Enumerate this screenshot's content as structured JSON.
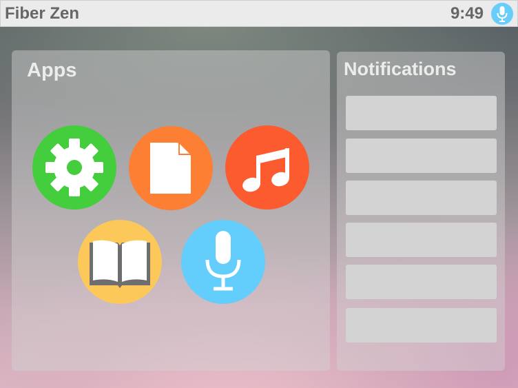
{
  "status_bar": {
    "title": "Fiber Zen",
    "time": "9:49",
    "icon": "microphone-icon"
  },
  "apps": {
    "title": "Apps",
    "items": [
      {
        "name": "settings",
        "icon": "gear-icon",
        "color": "#44cd3c"
      },
      {
        "name": "documents",
        "icon": "document-icon",
        "color": "#fc7f33"
      },
      {
        "name": "music",
        "icon": "music-note-icon",
        "color": "#fb5b2e"
      },
      {
        "name": "books",
        "icon": "book-icon",
        "color": "#fdc85a"
      },
      {
        "name": "voice",
        "icon": "microphone-icon",
        "color": "#63cdfb"
      }
    ]
  },
  "notifications": {
    "title": "Notifications",
    "slots": 6
  },
  "colors": {
    "status_bar_bg": "#ebebeb",
    "status_text": "#666666",
    "panel_text": "#ececec",
    "notification_slot": "#d3d3d3"
  }
}
